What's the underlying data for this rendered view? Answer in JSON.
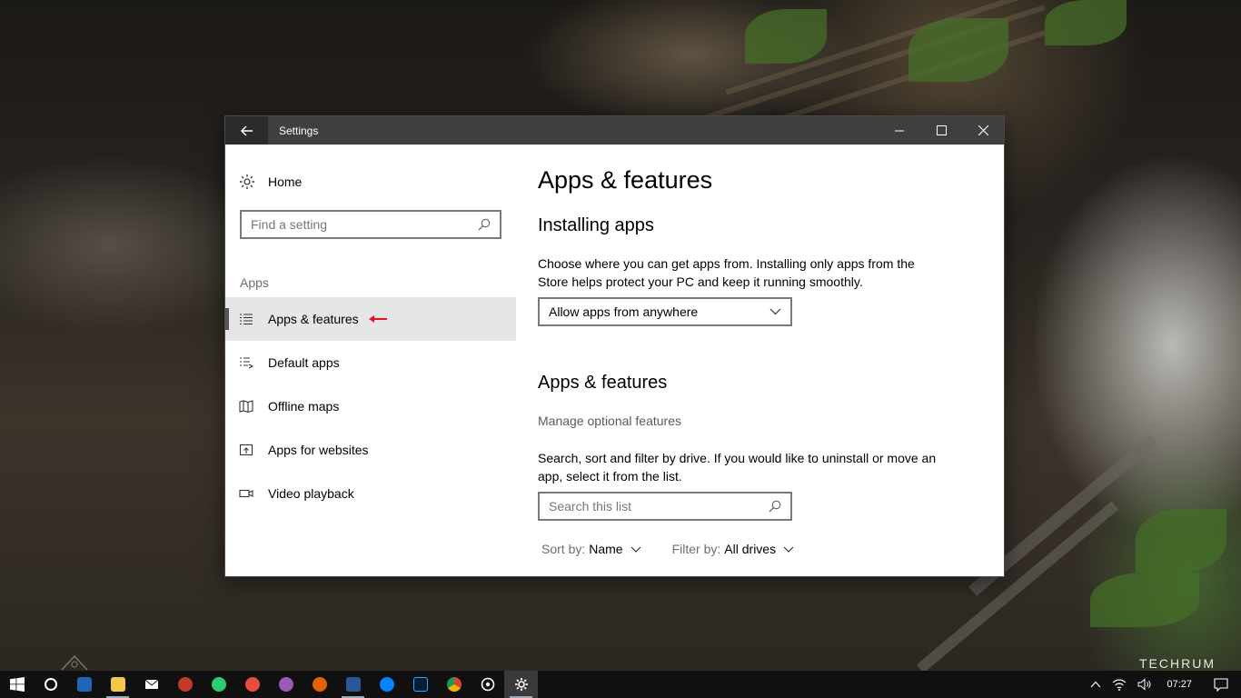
{
  "window": {
    "title": "Settings"
  },
  "sidebar": {
    "home_label": "Home",
    "search_placeholder": "Find a setting",
    "section_heading": "Apps",
    "items": [
      {
        "label": "Apps & features",
        "icon": "list-icon",
        "active": true
      },
      {
        "label": "Default apps",
        "icon": "default-apps-icon",
        "active": false
      },
      {
        "label": "Offline maps",
        "icon": "map-icon",
        "active": false
      },
      {
        "label": "Apps for websites",
        "icon": "open-in-app-icon",
        "active": false
      },
      {
        "label": "Video playback",
        "icon": "video-icon",
        "active": false
      }
    ]
  },
  "content": {
    "page_title": "Apps & features",
    "installing": {
      "heading": "Installing apps",
      "description": "Choose where you can get apps from. Installing only apps from the Store helps protect your PC and keep it running smoothly.",
      "dropdown_value": "Allow apps from anywhere"
    },
    "apps_features": {
      "heading": "Apps & features",
      "manage_link": "Manage optional features",
      "description": "Search, sort and filter by drive. If you would like to uninstall or move an app, select it from the list.",
      "search_placeholder": "Search this list",
      "sort_label": "Sort by:",
      "sort_value": "Name",
      "filter_label": "Filter by:",
      "filter_value": "All drives"
    }
  },
  "watermark": "TECHRUM",
  "taskbar": {
    "apps": [
      "start-icon",
      "cortana-icon",
      "gotv-icon",
      "file-explorer-icon",
      "mail-icon",
      "app-icon",
      "app-icon",
      "app-icon",
      "app-icon",
      "firefox-icon",
      "word-icon",
      "messenger-icon",
      "photoshop-icon",
      "chrome-icon",
      "groove-icon",
      "settings-icon"
    ],
    "clock": "07:27"
  },
  "colors": {
    "accent_arrow": "#e81123",
    "titlebar": "#3f3f3f",
    "taskbar": "#101010"
  }
}
